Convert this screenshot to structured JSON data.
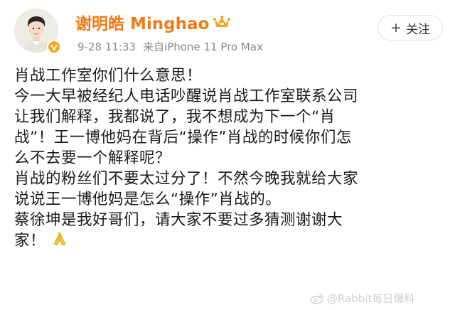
{
  "user": {
    "name": "谢明皓 Minghao",
    "date": "9-28 11:33",
    "source": "来自iPhone 11 Pro Max"
  },
  "follow_button": {
    "label": "关注"
  },
  "post": {
    "lines": [
      "肖战工作室你们什么意思！",
      "今一大早被经纪人电话吵醒说肖战工作室联系公司",
      "让我们解释，我都说了，我不想成为下一个“肖",
      "战”！王一博他妈在背后“操作”肖战的时候你们怎",
      "么不去要一个解释呢？",
      "肖战的粉丝们不要太过分了！不然今晚我就给大家",
      "说说王一博他妈是怎么“操作”肖战的。",
      "蔡徐坤是我好哥们，请大家不要过多猜测谢谢大",
      "家！"
    ],
    "emoji": "folded-hands-icon"
  },
  "watermark": {
    "text": "@Rabbit每日爆料"
  },
  "colors": {
    "username": "#f07a18",
    "badge": "#f5a623",
    "meta": "#888888"
  }
}
